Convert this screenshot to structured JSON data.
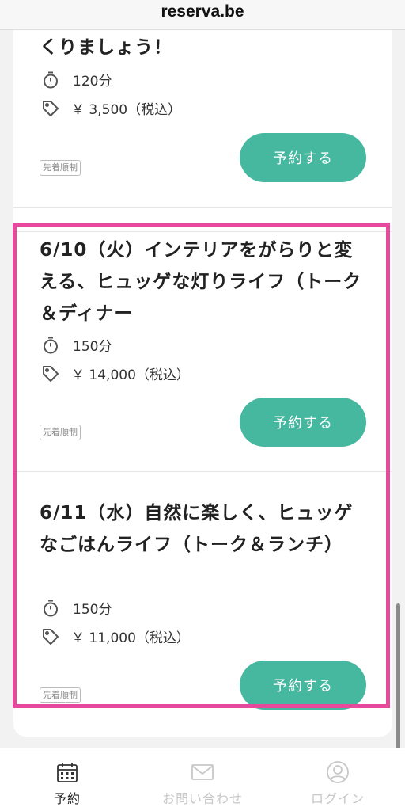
{
  "browser": {
    "url": "reserva.be"
  },
  "events": [
    {
      "title": "くりましょう！",
      "duration": "120分",
      "price": "￥ 3,500（税込）",
      "badge": "先着順制",
      "button": "予約する"
    },
    {
      "title": "6/10（火）インテリアをがらりと変える、ヒュッゲな灯りライフ（トーク＆ディナー",
      "duration": "150分",
      "price": "￥ 14,000（税込）",
      "badge": "先着順制",
      "button": "予約する"
    },
    {
      "title": "6/11（水）自然に楽しく、ヒュッゲなごはんライフ（トーク＆ランチ）",
      "duration": "150分",
      "price": "￥ 11,000（税込）",
      "badge": "先着順制",
      "button": "予約する"
    }
  ],
  "bottom_nav": [
    {
      "label": "予約",
      "icon": "calendar-icon",
      "active": true
    },
    {
      "label": "お問い合わせ",
      "icon": "mail-icon",
      "active": false
    },
    {
      "label": "ログイン",
      "icon": "user-icon",
      "active": false
    }
  ],
  "colors": {
    "accent": "#47b8a0",
    "highlight": "#e8499c"
  }
}
